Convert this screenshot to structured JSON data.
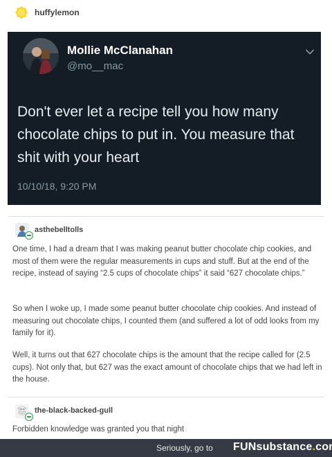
{
  "post": {
    "author": "huffylemon"
  },
  "tweet": {
    "name": "Mollie McClanahan",
    "handle": "@mo__mac",
    "text": "Don't ever let a recipe tell you how many chocolate chips to put in. You measure that shit with your heart",
    "date": "10/10/18, 9:20 PM"
  },
  "reblogs": [
    {
      "username": "asthebelltolls",
      "paragraphs": [
        "One time, I had a dream that I was making peanut butter chocolate chip cookies, and most of them were the regular measurements in cups and stuff. But at the end of the recipe, instead of saying “2.5 cups of chocolate chips” it said “627 chocolate chips.”",
        "So when I woke up, I made some peanut butter chocolate chip cookies. And instead of measuring out chocolate chips, I counted them (and suffered a lot of odd looks from my family for it).",
        "Well, it turns out that 627 chocolate chips is the amount that the recipe called for (2.5 cups). Not only that, but 627 was the exact amount of chocolate chips that we had left in the house."
      ]
    },
    {
      "username": "the-black-backed-gull",
      "paragraphs": [
        "Forbidden knowledge was granted you that night"
      ]
    }
  ],
  "footer": {
    "text": "Seriously, go to",
    "logo_main": "FUNsubstance",
    "logo_dot": ".",
    "logo_end": "com"
  },
  "colors": {
    "tweet_bg": "#141d26",
    "footer_bg": "#353a44",
    "accent_green": "#2e9e4f",
    "logo_dot": "#f0c808"
  }
}
